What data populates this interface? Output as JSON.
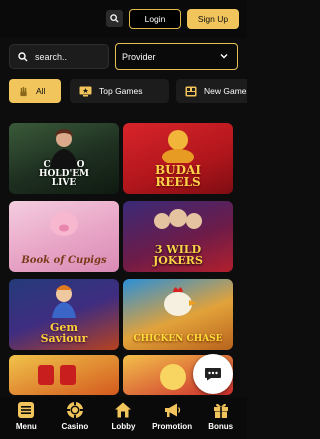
{
  "header": {
    "login_label": "Login",
    "signup_label": "Sign Up"
  },
  "filters": {
    "search_placeholder": "search..",
    "provider_label": "Provider"
  },
  "tabs": [
    {
      "label": "All",
      "active": true,
      "icon": "hand-icon"
    },
    {
      "label": "Top Games",
      "active": false,
      "icon": "star-screen-icon"
    },
    {
      "label": "New Games",
      "active": false,
      "icon": "new-games-icon"
    }
  ],
  "games": [
    {
      "title": "CASINO\nHOLD'EM\nLIVE"
    },
    {
      "title": "BUDAI\nREELS"
    },
    {
      "title": "Book of Cupigs"
    },
    {
      "title": "3 WILD\nJOKERS"
    },
    {
      "title": "Gem\nSaviour"
    },
    {
      "title": "CHICKEN CHASE"
    },
    {
      "title": ""
    },
    {
      "title": ""
    }
  ],
  "bottom_nav": [
    {
      "label": "Menu",
      "icon": "menu-icon"
    },
    {
      "label": "Casino",
      "icon": "chip-icon"
    },
    {
      "label": "Lobby",
      "icon": "home-icon"
    },
    {
      "label": "Promotion",
      "icon": "megaphone-icon"
    },
    {
      "label": "Bonus",
      "icon": "gift-icon"
    }
  ],
  "colors": {
    "accent": "#f2c55c",
    "background": "#0d0d0d",
    "surface": "#1c1c1c"
  }
}
